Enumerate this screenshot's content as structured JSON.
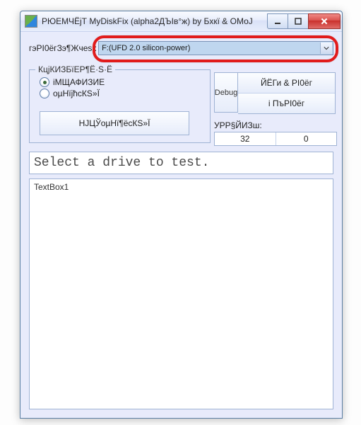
{
  "window": {
    "title": "РЮЕМЧЁјТ MyDiskFix (alpha2ДЪІв°ж) by Бхкї & ОМоЈ"
  },
  "topbar": {
    "label": "гэРІ0ёгЗэ¶Жчеѕ :",
    "drive_value": "F:(UFD 2.0 silicon-power)"
  },
  "group": {
    "legend": "КцјКИЗБїЕР¶Ё·Ѕ·Ё",
    "radio1": "іМЩАФИЗИЕ",
    "radio2": "оµНїјћcКЅ»Ї",
    "button": "НЈЦЎоµНї¶ёсКЅ»Ї"
  },
  "rightbtns": {
    "debug": "Debug",
    "top": "ЙЁГи & РІ0ёг",
    "bottom": "і ПъРІ0ёг"
  },
  "table": {
    "label": "УРР§ЙИЗш:",
    "c0": "32",
    "c1": "0"
  },
  "status": {
    "text": "Select a drive to test."
  },
  "textbox": {
    "value": "TextBox1"
  }
}
